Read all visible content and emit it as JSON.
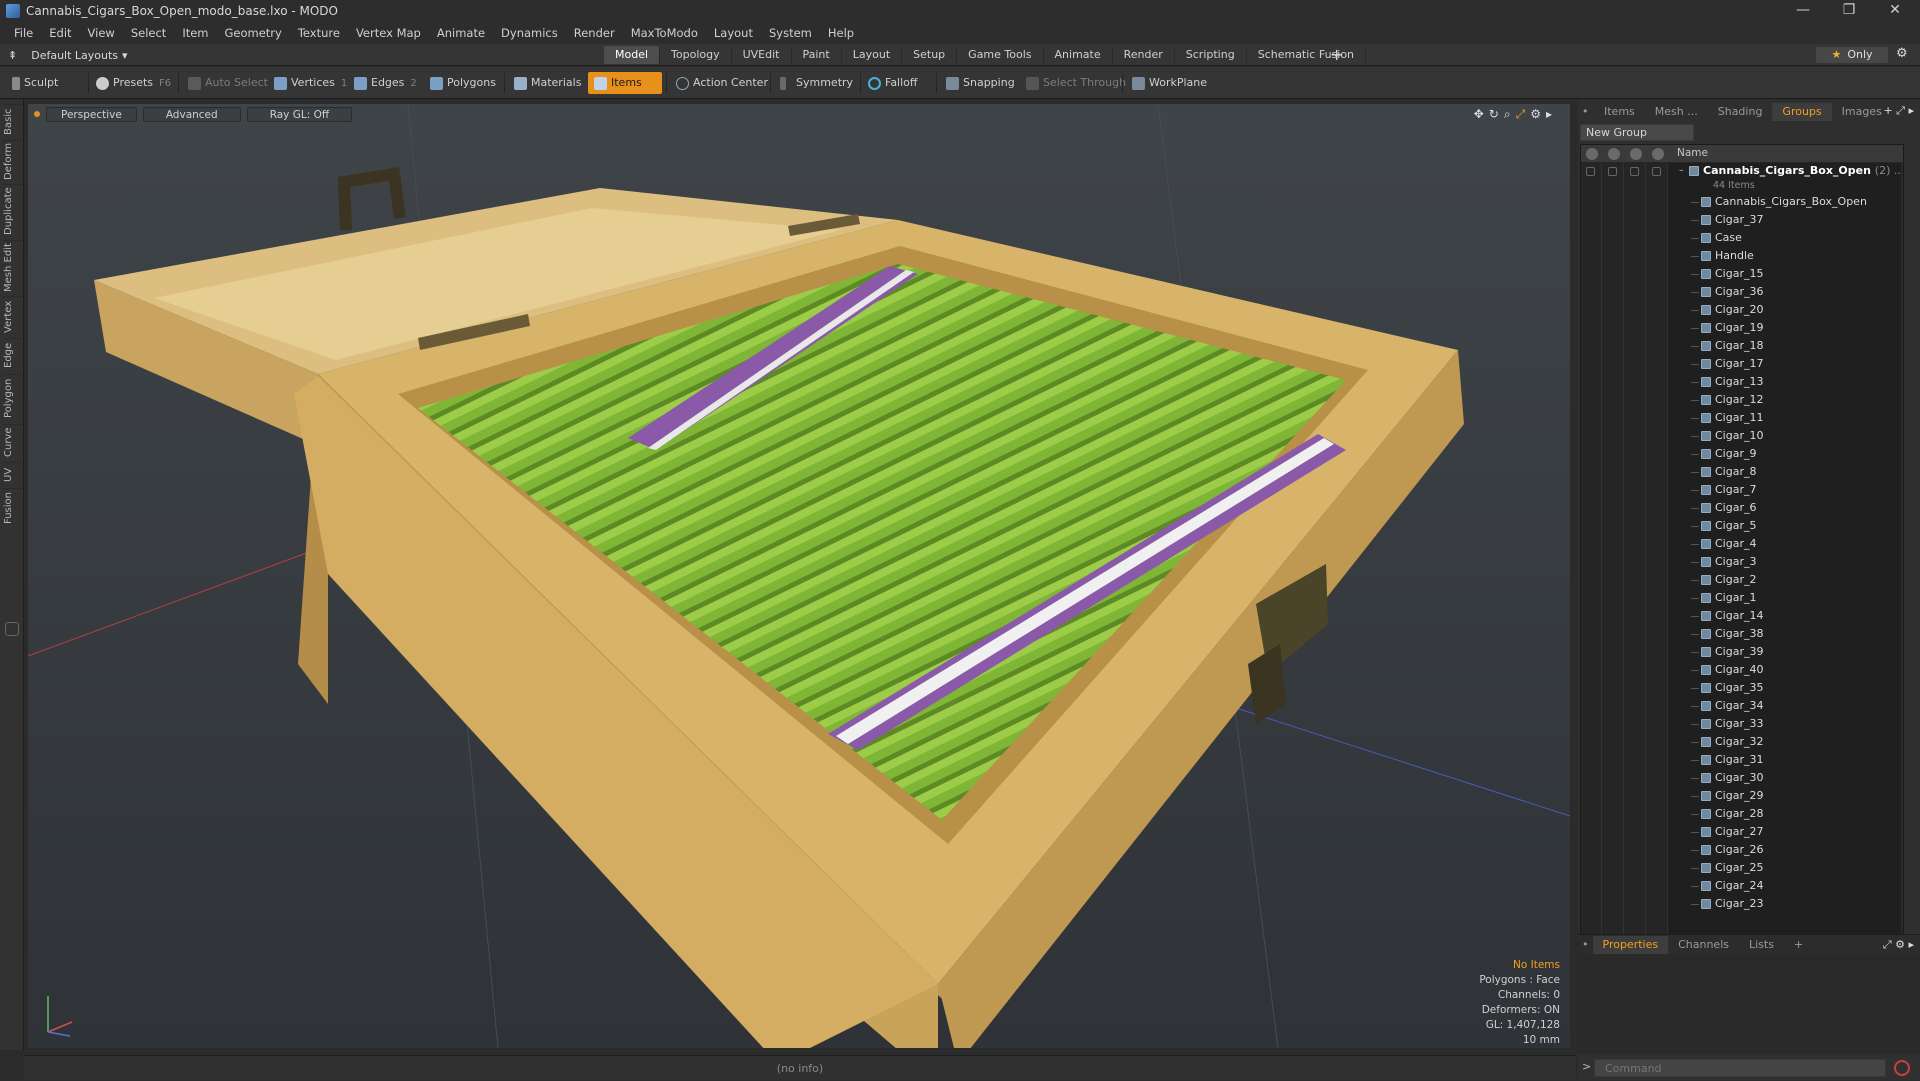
{
  "window": {
    "title": "Cannabis_Cigars_Box_Open_modo_base.lxo - MODO",
    "controls": [
      "—",
      "❐",
      "✕"
    ]
  },
  "menu": [
    "File",
    "Edit",
    "View",
    "Select",
    "Item",
    "Geometry",
    "Texture",
    "Vertex Map",
    "Animate",
    "Dynamics",
    "Render",
    "MaxToModo",
    "Layout",
    "System",
    "Help"
  ],
  "layout": {
    "selector": "Default Layouts",
    "tabs": [
      "Model",
      "Topology",
      "UVEdit",
      "Paint",
      "Layout",
      "Setup",
      "Game Tools",
      "Animate",
      "Render",
      "Scripting",
      "Schematic Fusion"
    ],
    "active_tab": "Model",
    "only_label": "Only"
  },
  "toolbar": {
    "sculpt": "Sculpt",
    "presets": "Presets",
    "presets_key": "F6",
    "auto_select": "Auto Select",
    "vertices": "Vertices",
    "vertices_count": "1",
    "edges": "Edges",
    "edges_count": "2",
    "polygons": "Polygons",
    "materials": "Materials",
    "items": "Items",
    "action_center": "Action Center",
    "symmetry": "Symmetry",
    "falloff": "Falloff",
    "snapping": "Snapping",
    "select_through": "Select Through",
    "workplane": "WorkPlane"
  },
  "left_tabs": [
    "Basic",
    "Deform",
    "Duplicate",
    "Mesh Edit",
    "Vertex",
    "Edge",
    "Polygon",
    "Curve",
    "UV",
    "Fusion"
  ],
  "viewport": {
    "view_mode": "Perspective",
    "shading": "Advanced",
    "raygl": "Ray GL: Off",
    "info": {
      "selection": "No Items",
      "polygons": "Polygons : Face",
      "channels": "Channels: 0",
      "deformers": "Deformers: ON",
      "gl": "GL: 1,407,128",
      "scale": "10 mm"
    },
    "colors": {
      "box_outer": "#d9b66e",
      "box_inner": "#c8a35a",
      "cigar_green": "#8ac43a",
      "band_purple": "#8a5aa8"
    }
  },
  "status": "(no info)",
  "right_panel": {
    "tabs": [
      "Items",
      "Mesh ...",
      "Shading",
      "Groups",
      "Images"
    ],
    "active_tab": "Groups",
    "new_group": "New Group",
    "column_name": "Name",
    "group": {
      "name": "Cannabis_Cigars_Box_Open",
      "count_suffix": "(2) ...",
      "items_count": "44 Items"
    },
    "items": [
      "Cannabis_Cigars_Box_Open",
      "Cigar_37",
      "Case",
      "Handle",
      "Cigar_15",
      "Cigar_36",
      "Cigar_20",
      "Cigar_19",
      "Cigar_18",
      "Cigar_17",
      "Cigar_13",
      "Cigar_12",
      "Cigar_11",
      "Cigar_10",
      "Cigar_9",
      "Cigar_8",
      "Cigar_7",
      "Cigar_6",
      "Cigar_5",
      "Cigar_4",
      "Cigar_3",
      "Cigar_2",
      "Cigar_1",
      "Cigar_14",
      "Cigar_38",
      "Cigar_39",
      "Cigar_40",
      "Cigar_35",
      "Cigar_34",
      "Cigar_33",
      "Cigar_32",
      "Cigar_31",
      "Cigar_30",
      "Cigar_29",
      "Cigar_28",
      "Cigar_27",
      "Cigar_26",
      "Cigar_25",
      "Cigar_24",
      "Cigar_23"
    ],
    "bottom_tabs": [
      "Properties",
      "Channels",
      "Lists"
    ],
    "bottom_active": "Properties",
    "command_placeholder": "Command"
  }
}
